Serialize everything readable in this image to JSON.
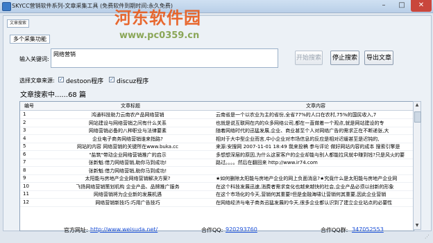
{
  "window": {
    "title": "SKYCC营销软件系列-文章采集工具 (免费软件到期时间:永久免费)",
    "buttons": {
      "minimize": "–",
      "maximize": "□",
      "close": "✕"
    }
  },
  "watermark": {
    "text": "河东软件园",
    "url": "www.pc0359.cn"
  },
  "tab": {
    "label": "文章搜索"
  },
  "selected_function": {
    "label": "多个采集功能"
  },
  "keyword": {
    "label": "输入关键词:",
    "value": "网络营销"
  },
  "actions": {
    "start": "开始搜索",
    "stop": "停止搜索",
    "export": "导出文章"
  },
  "sources": {
    "label": "选择文章来源:",
    "items": [
      {
        "label": "destoon程序",
        "checked": true
      },
      {
        "label": "discuz程序",
        "checked": true
      }
    ]
  },
  "status": {
    "text": "文章搜索中......68 篇"
  },
  "table": {
    "columns": [
      "编号",
      "文章标题",
      "文章内容"
    ],
    "rows": [
      {
        "no": "1",
        "title": "鸿通科技助力云南农产品网络营销",
        "content": "云南省是一个以农业为主的省份,全省77%的人口在农村,75%的国民收入,7"
      },
      {
        "no": "2",
        "title": "网站建设与网络营销之间有什么关系",
        "content": "也就是说互联网在内的众多网络公司,都在一直做着一个观点,就是网站建设的专"
      },
      {
        "no": "3",
        "title": "网络营销必备的八种职业与法律要素",
        "content": "随着网络时代的迅猛发展,企业、商业甚至个人对网络广告的需求正在不断递张,大"
      },
      {
        "no": "4",
        "title": "企业电子商务网络营销谁来指路?",
        "content": "相对于大中型企业而言,中小企业对市场信息的反应是相对迟缓甚至是迟钝的,"
      },
      {
        "no": "5",
        "title": "网站的内容 网络营销的关键所在www.buka.cc",
        "content": "来源:安搜网 2007-11-01 18:49 我来投稿 参与评论 做好网站内容的成本 搜索引擎是"
      },
      {
        "no": "6",
        "title": "\"盐筑\"带动企业网络营销推广的启示",
        "content": "多想想深层的原因,为什么这家客户的企业却能与别人都能拉风就中赚到钱?只是风火的要"
      },
      {
        "no": "7",
        "title": "张新魁:借力网络营销,助你马到成功!",
        "content": "路过。。。。然后在翻回来 http://www.ir74.com"
      },
      {
        "no": "8",
        "title": "张新魁:借力网络营销,助你马到成功!",
        "content": ""
      },
      {
        "no": "9",
        "title": "太阳能与房地产企业网络营销解决方案?",
        "content": "★如何删除太阳能与房地产企业的网上负面消息?★究竟什么是太阳能与房地产企业网"
      },
      {
        "no": "10",
        "title": "飞扬网络营销策划机构 企业产品、品牌推广服务",
        "content": "在这个科技发展迅速,消费者需求变化也越来越快的社会,企业产品必须以创新的形象"
      },
      {
        "no": "11",
        "title": "网络营销将为企业新的发展机遇",
        "content": "在这个市场化的今天,营销何其重要!但是金融海啸让营销何其重要,因此企业营销"
      },
      {
        "no": "12",
        "title": "网络营销新技巧:巧用广告技巧",
        "content": "在网络经济与电子商务迅猛发展的今天,很多企业都认识到了建立企业站点的必要性"
      }
    ]
  },
  "footer": {
    "site_label": "官方网址:",
    "site_url": "http://www.weisuda.net/",
    "qq_label": "合作QQ:",
    "qq_value": "920293760",
    "qq_group_label": "合作QQ群:",
    "qq_group_value": "347052553"
  },
  "colors": {
    "accent": "#1a4fd6",
    "watermark": "#e85a1a",
    "close": "#c9463c"
  }
}
